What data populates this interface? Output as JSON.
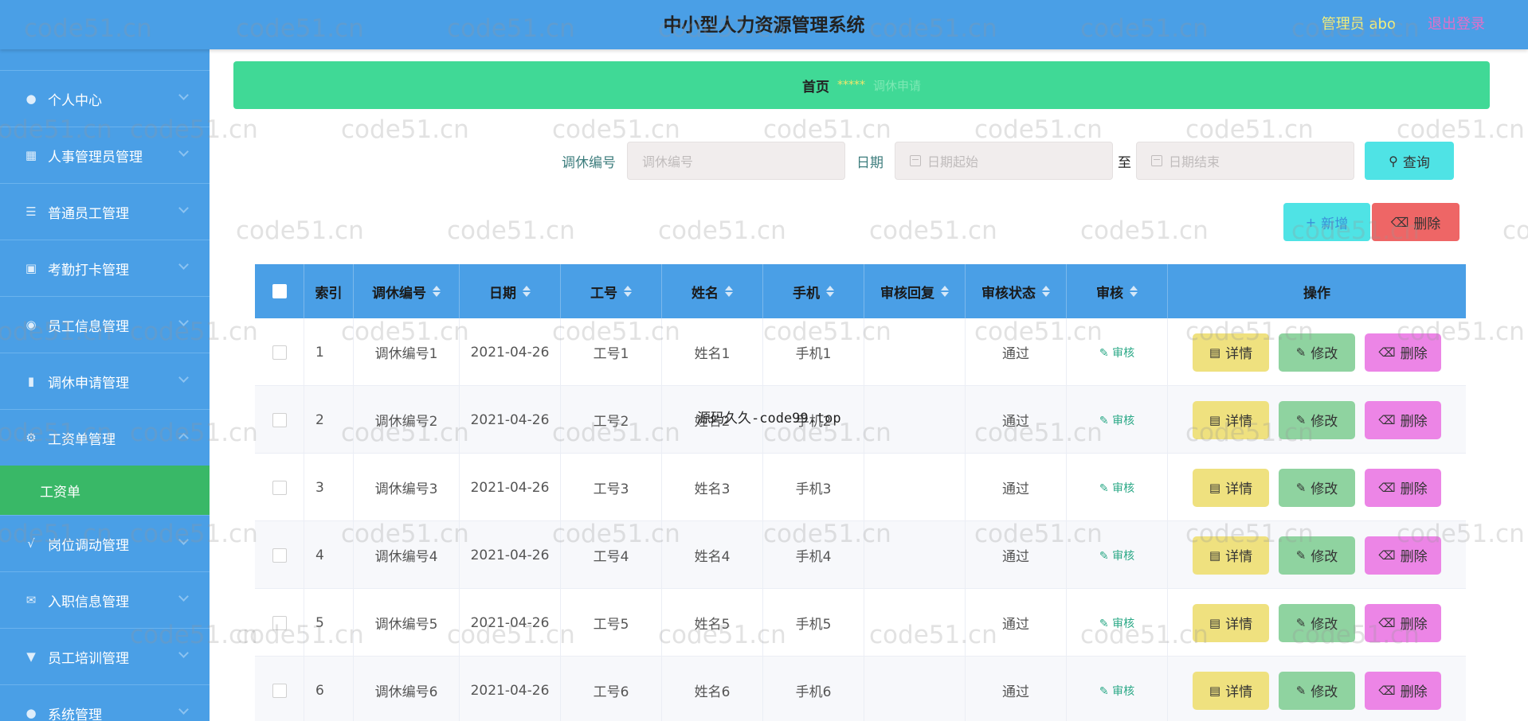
{
  "header": {
    "title": "中小型人力资源管理系统",
    "user": "管理员 abo",
    "logout": "退出登录"
  },
  "sidebar": {
    "items": [
      {
        "label": "个人中心",
        "icon": "person-icon"
      },
      {
        "label": "人事管理员管理",
        "icon": "grid-icon"
      },
      {
        "label": "普通员工管理",
        "icon": "list-icon"
      },
      {
        "label": "考勤打卡管理",
        "icon": "clipboard-icon"
      },
      {
        "label": "员工信息管理",
        "icon": "info-icon"
      },
      {
        "label": "调休申请管理",
        "icon": "chart-icon"
      },
      {
        "label": "工资单管理",
        "icon": "settings-icon",
        "expanded": true
      },
      {
        "label": "岗位调动管理",
        "icon": "transfer-icon"
      },
      {
        "label": "入职信息管理",
        "icon": "mail-icon"
      },
      {
        "label": "员工培训管理",
        "icon": "training-icon"
      },
      {
        "label": "系统管理",
        "icon": "person-icon"
      }
    ],
    "sub_item": "工资单"
  },
  "breadcrumb": {
    "home": "首页",
    "stars": "*****",
    "current": "调休申请"
  },
  "search": {
    "id_label": "调休编号",
    "id_placeholder": "调休编号",
    "date_label": "日期",
    "date_start_placeholder": "日期起始",
    "to": "至",
    "date_end_placeholder": "日期结束",
    "query_button": "查询"
  },
  "toolbar": {
    "add": "新增",
    "delete": "删除"
  },
  "table": {
    "columns": [
      "索引",
      "调休编号",
      "日期",
      "工号",
      "姓名",
      "手机",
      "审核回复",
      "审核状态",
      "审核"
    ],
    "op_column": "操作",
    "rows": [
      {
        "index": "1",
        "code": "调休编号1",
        "date": "2021-04-26",
        "emp_no": "工号1",
        "name": "姓名1",
        "phone": "手机1",
        "reply": "",
        "status": "通过",
        "audit": "审核"
      },
      {
        "index": "2",
        "code": "调休编号2",
        "date": "2021-04-26",
        "emp_no": "工号2",
        "name": "姓名2",
        "phone": "手机2",
        "reply": "",
        "status": "通过",
        "audit": "审核"
      },
      {
        "index": "3",
        "code": "调休编号3",
        "date": "2021-04-26",
        "emp_no": "工号3",
        "name": "姓名3",
        "phone": "手机3",
        "reply": "",
        "status": "通过",
        "audit": "审核"
      },
      {
        "index": "4",
        "code": "调休编号4",
        "date": "2021-04-26",
        "emp_no": "工号4",
        "name": "姓名4",
        "phone": "手机4",
        "reply": "",
        "status": "通过",
        "audit": "审核"
      },
      {
        "index": "5",
        "code": "调休编号5",
        "date": "2021-04-26",
        "emp_no": "工号5",
        "name": "姓名5",
        "phone": "手机5",
        "reply": "",
        "status": "通过",
        "audit": "审核"
      },
      {
        "index": "6",
        "code": "调休编号6",
        "date": "2021-04-26",
        "emp_no": "工号6",
        "name": "姓名6",
        "phone": "手机6",
        "reply": "",
        "status": "通过",
        "audit": "审核"
      }
    ],
    "actions": {
      "detail": "详情",
      "edit": "修改",
      "delete": "删除"
    }
  },
  "overlay_note": "源码久久-code99.top",
  "watermark": "code51.cn",
  "colors": {
    "header": "#4a9fe6",
    "banner": "#40d996",
    "sidebar_active": "#39b867",
    "detail": "#efe17f",
    "edit": "#8fd3a0",
    "delete": "#ec85e6"
  }
}
